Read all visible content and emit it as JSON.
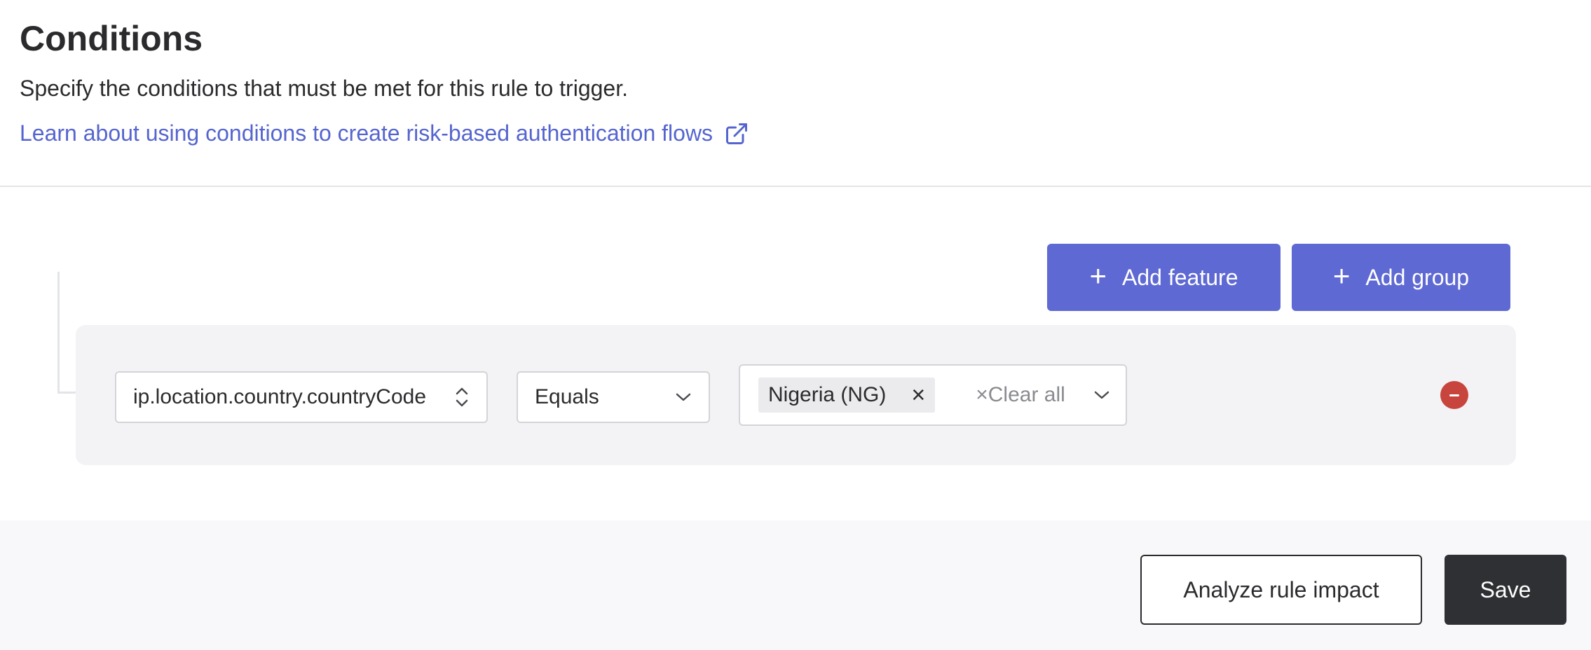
{
  "header": {
    "title": "Conditions",
    "subtitle": "Specify the conditions that must be met for this rule to trigger.",
    "link_text": "Learn about using conditions to create risk-based authentication flows",
    "link_icon": "external-link-icon"
  },
  "toolbar": {
    "add_feature_label": "Add feature",
    "add_group_label": "Add group"
  },
  "condition": {
    "feature": "ip.location.country.countryCode",
    "operator": "Equals",
    "values": [
      "Nigeria (NG)"
    ],
    "clear_all_label": "Clear all"
  },
  "footer": {
    "analyze_label": "Analyze rule impact",
    "save_label": "Save"
  },
  "colors": {
    "primary": "#5e69d3",
    "link": "#5565cf",
    "danger": "#c7453c",
    "dark_button": "#2f3034"
  }
}
